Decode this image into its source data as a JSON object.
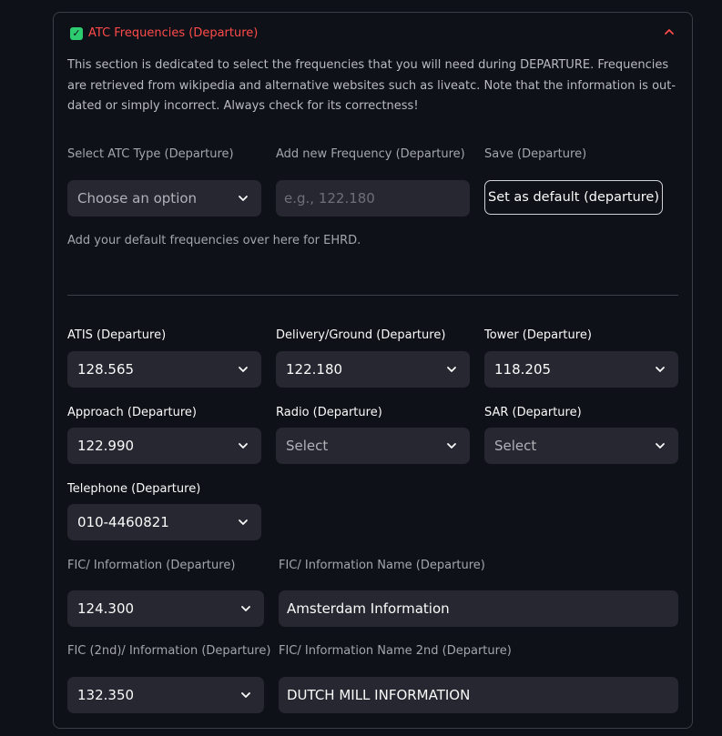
{
  "expander": {
    "title": "ATC Frequencies (Departure)",
    "description": "This section is dedicated to select the frequencies that you will need during DEPARTURE. Frequencies are retrieved from wikipedia and alternative websites such as liveatc. Note that the information is out-dated or simply incorrect. Always check for its correctness!",
    "check_icon": "checkbox-checked-icon",
    "collapse_icon": "chevron-up-icon",
    "accent_color": "#ff4b4b",
    "check_color": "#2ecc71"
  },
  "top_row": {
    "atc_type": {
      "label": "Select ATC Type (Departure)",
      "value": "Choose an option"
    },
    "new_freq": {
      "label": "Add new Frequency (Departure)",
      "placeholder": "e.g., 122.180"
    },
    "save": {
      "label": "Save (Departure)",
      "button": "Set as default (departure)"
    }
  },
  "default_note": "Add your default frequencies over here for EHRD.",
  "freqs": {
    "atis": {
      "label": "ATIS (Departure)",
      "value": "128.565"
    },
    "delivery": {
      "label": "Delivery/Ground (Departure)",
      "value": "122.180"
    },
    "tower": {
      "label": "Tower (Departure)",
      "value": "118.205"
    },
    "approach": {
      "label": "Approach (Departure)",
      "value": "122.990"
    },
    "radio": {
      "label": "Radio (Departure)",
      "value": "Select"
    },
    "sar": {
      "label": "SAR (Departure)",
      "value": "Select"
    },
    "telephone": {
      "label": "Telephone (Departure)",
      "value": "010-4460821"
    }
  },
  "fic": {
    "info": {
      "label": "FIC/ Information (Departure)",
      "value": "124.300"
    },
    "info_name": {
      "label": "FIC/ Information Name (Departure)",
      "value": "Amsterdam Information"
    },
    "info2": {
      "label": "FIC (2nd)/ Information (Departure)",
      "value": "132.350"
    },
    "info2_name": {
      "label": "FIC/ Information Name 2nd (Departure)",
      "value": "DUTCH MILL INFORMATION"
    }
  }
}
